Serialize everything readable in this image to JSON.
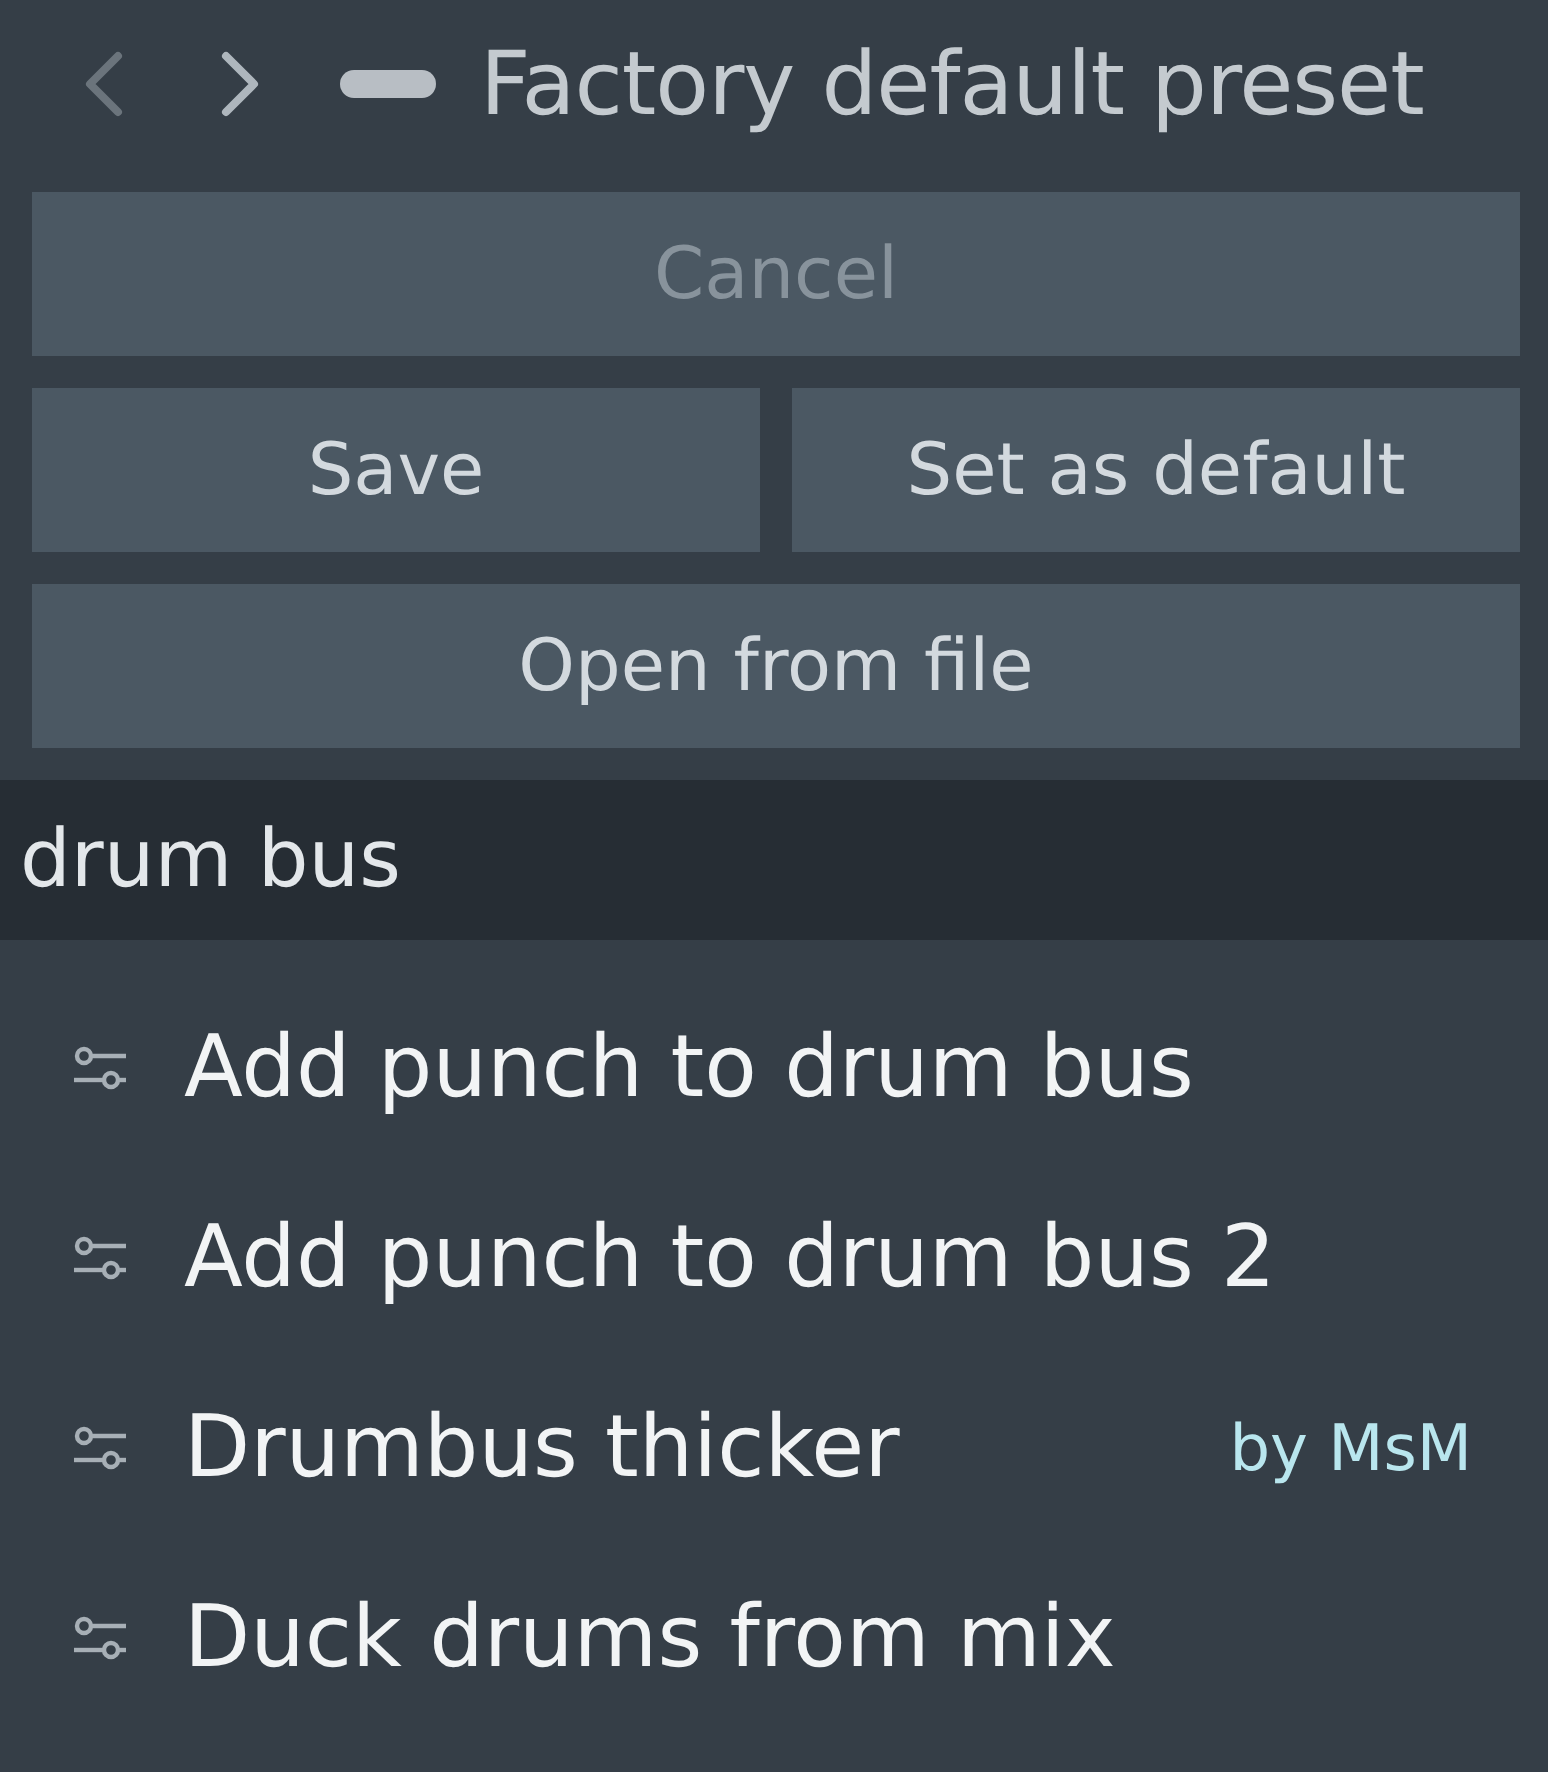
{
  "header": {
    "back_disabled": true,
    "forward_disabled": false,
    "title": "Factory default preset"
  },
  "button_rows": [
    [
      {
        "label": "Cancel",
        "disabled": true
      }
    ],
    [
      {
        "label": "Save",
        "disabled": false
      },
      {
        "label": "Set as default",
        "disabled": false
      }
    ],
    [
      {
        "label": "Open from file",
        "disabled": false
      }
    ]
  ],
  "search": {
    "value": "drum bus"
  },
  "results": [
    {
      "name": "Add punch to drum bus"
    },
    {
      "name": "Add punch to drum bus 2"
    },
    {
      "name": "Drumbus thicker",
      "author": "by MsM"
    },
    {
      "name": "Duck drums from mix"
    }
  ]
}
